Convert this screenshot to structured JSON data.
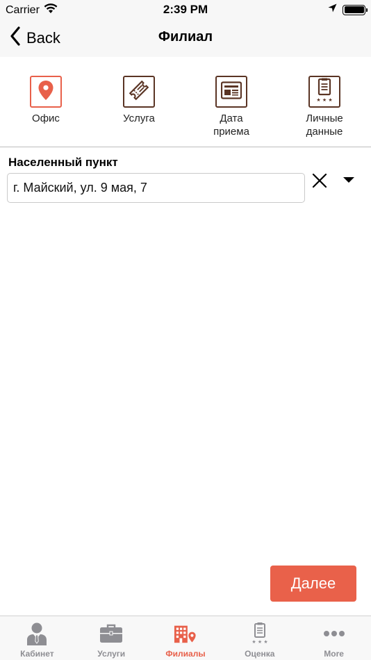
{
  "status_bar": {
    "carrier": "Carrier",
    "time": "2:39 PM"
  },
  "nav": {
    "back_label": "Back",
    "title": "Филиал"
  },
  "steps": [
    {
      "label": "Офис",
      "icon": "location-pin-icon",
      "active": true
    },
    {
      "label": "Услуга",
      "icon": "ticket-icon",
      "active": false
    },
    {
      "label": "Дата\nприема",
      "icon": "newspaper-icon",
      "active": false
    },
    {
      "label": "Личные\nданные",
      "icon": "clipboard-stars-icon",
      "active": false
    }
  ],
  "field": {
    "label": "Населенный пункт",
    "value": "г. Майский, ул. 9 мая, 7"
  },
  "next_label": "Далее",
  "tabs": [
    {
      "label": "Кабинет",
      "icon": "person-icon",
      "active": false
    },
    {
      "label": "Услуги",
      "icon": "briefcase-icon",
      "active": false
    },
    {
      "label": "Филиалы",
      "icon": "building-pin-icon",
      "active": true
    },
    {
      "label": "Оценка",
      "icon": "clipboard-stars-icon",
      "active": false
    },
    {
      "label": "More",
      "icon": "more-dots-icon",
      "active": false
    }
  ],
  "colors": {
    "accent": "#e8604a",
    "icon_brown": "#5a3424",
    "tab_inactive": "#8e8e93"
  }
}
